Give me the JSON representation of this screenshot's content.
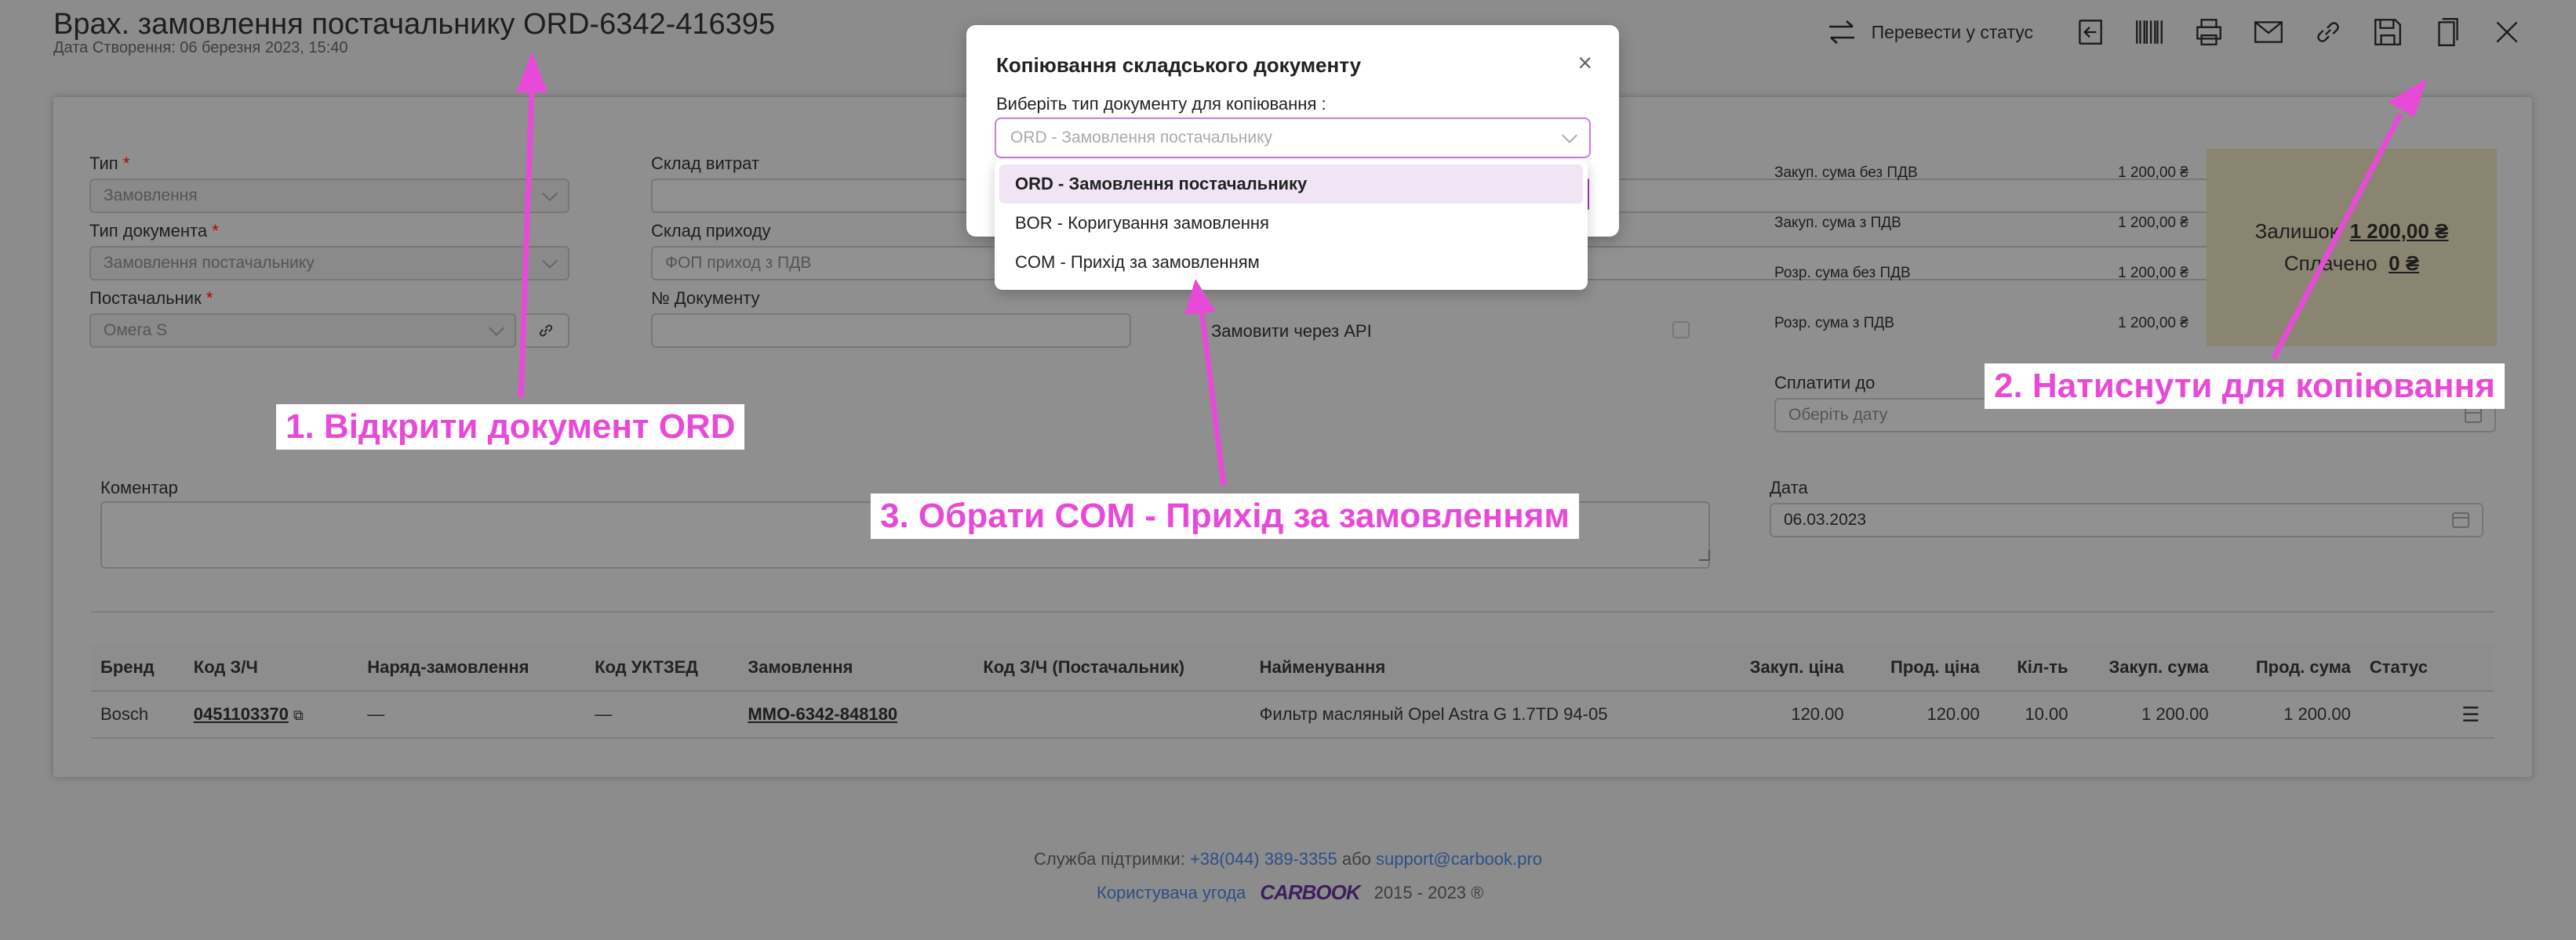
{
  "header": {
    "title": "Врах. замовлення постачальнику ORD-6342-416395",
    "subtitle": "Дата Створення: 06 березня 2023, 15:40",
    "status_label": "Перевести у статус"
  },
  "form": {
    "type_label": "Тип",
    "type_value": "Замовлення",
    "doctype_label": "Тип документа",
    "doctype_value": "Замовлення постачальнику",
    "supplier_label": "Постачальник",
    "supplier_value": "Омега S",
    "warehouse_out_label": "Склад витрат",
    "warehouse_in_label": "Склад приходу",
    "warehouse_in_value": "ФОП приход з ПДВ",
    "docnum_label": "№ Документу",
    "api_label": "Замовити через API",
    "comment_label": "Коментар",
    "pay_until_label": "Сплатити до",
    "pay_until_placeholder": "Оберіть дату",
    "date_label": "Дата",
    "date_value": "06.03.2023"
  },
  "sums": [
    {
      "label": "Закуп. сума без ПДВ",
      "value": "1 200,00 ₴"
    },
    {
      "label": "Закуп. сума з ПДВ",
      "value": "1 200,00 ₴"
    },
    {
      "label": "Розр. сума без ПДВ",
      "value": "1 200,00 ₴"
    },
    {
      "label": "Розр. сума з ПДВ",
      "value": "1 200,00 ₴"
    }
  ],
  "balance": {
    "remain_label": "Залишок",
    "remain_value": "1 200,00 ₴",
    "paid_label": "Сплачено",
    "paid_value": "0 ₴"
  },
  "table": {
    "headers": [
      "Бренд",
      "Код З/Ч",
      "Наряд-замовлення",
      "Код УКТЗЕД",
      "Замовлення",
      "Код З/Ч (Постачальник)",
      "Найменування",
      "Закуп. ціна",
      "Прод. ціна",
      "Кіл-ть",
      "Закуп. сума",
      "Прод. сума",
      "Статус"
    ],
    "row": {
      "brand": "Bosch",
      "code": "0451103370",
      "work_order": "—",
      "uktzed": "—",
      "order": "MMO-6342-848180",
      "supplier_code": "",
      "name": "Фильтр масляный Opel Astra G 1.7TD 94-05",
      "buy_price": "120.00",
      "sell_price": "120.00",
      "qty": "10.00",
      "buy_sum": "1 200.00",
      "sell_sum": "1 200.00",
      "status": ""
    }
  },
  "footer": {
    "support_label": "Служба підтримки:",
    "phone": "+38(044) 389-3355",
    "or": "або",
    "email": "support@carbook.pro",
    "agreement": "Користувача угода",
    "logo": "CARBOOK",
    "years": "2015 - 2023 ®"
  },
  "modal": {
    "title": "Копіювання складського документу",
    "label": "Виберіть тип документу для копіювання :",
    "select_placeholder": "ORD - Замовлення постачальнику",
    "options": [
      "ORD - Замовлення постачальнику",
      "BOR - Коригування замовлення",
      "COM - Прихід за замовленням"
    ]
  },
  "annotations": {
    "a1": "1. Відкрити документ ORD",
    "a2": "2. Натиснути для копіювання",
    "a3": "3. Обрати COM - Прихід за замовленням"
  },
  "colors": {
    "accent": "#e84ad8",
    "modal_border": "#c77de0",
    "highlight": "#f1e5f5"
  }
}
